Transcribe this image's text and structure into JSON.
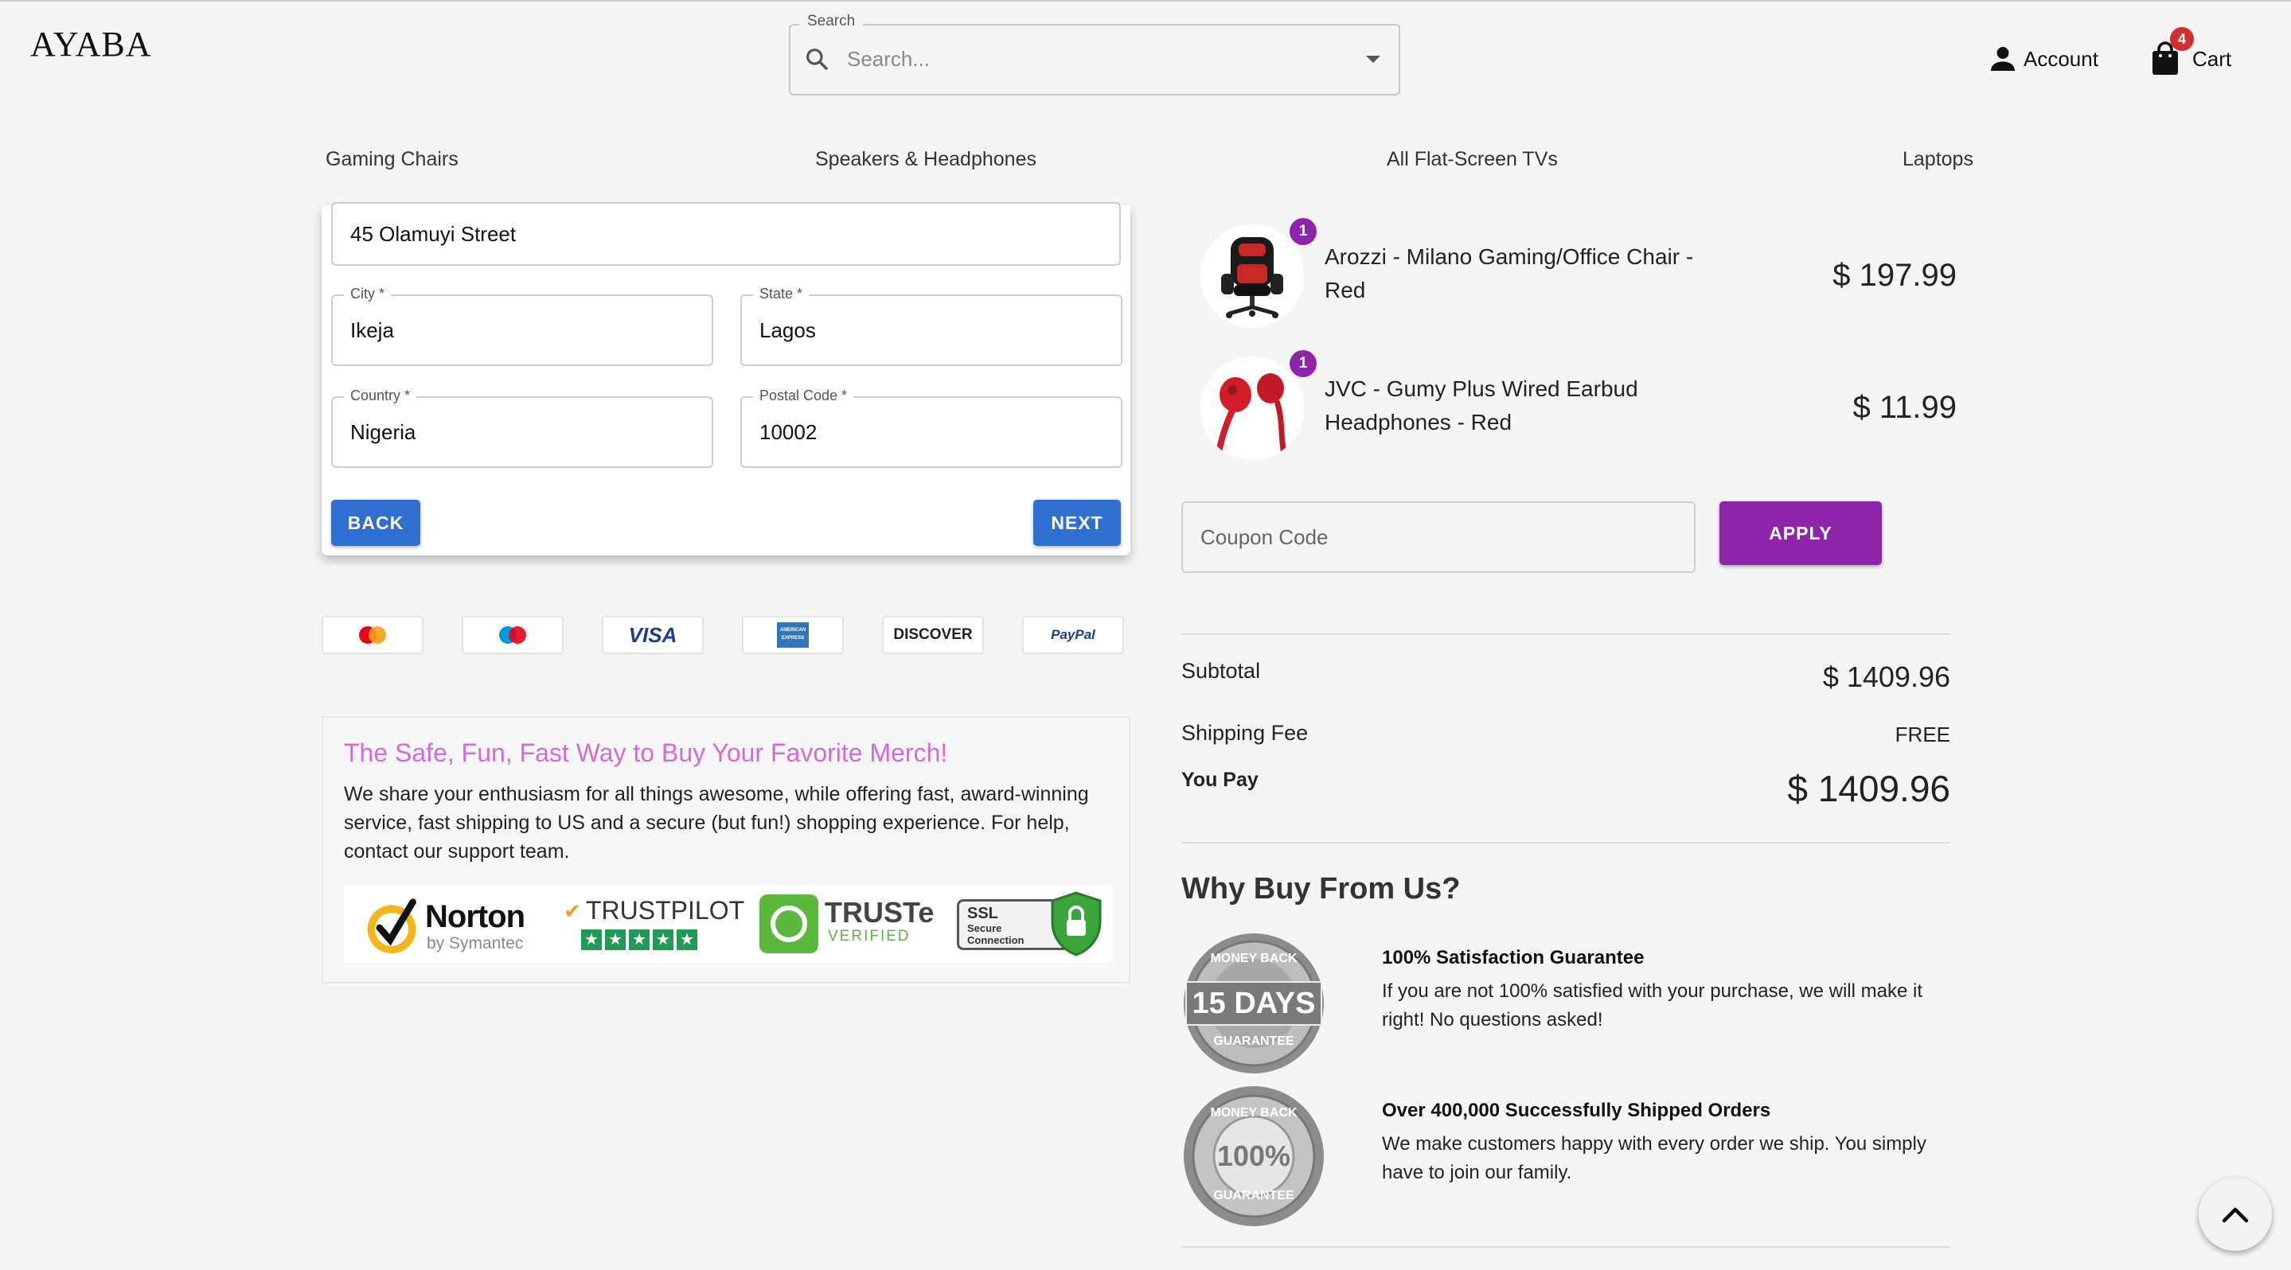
{
  "header": {
    "logo": "AYABA",
    "search": {
      "legend": "Search",
      "placeholder": "Search..."
    },
    "account_label": "Account",
    "cart_label": "Cart",
    "cart_count": "4"
  },
  "nav": {
    "items": [
      {
        "label": "Gaming Chairs"
      },
      {
        "label": "Speakers & Headphones"
      },
      {
        "label": "All Flat-Screen TVs"
      },
      {
        "label": "Laptops"
      }
    ]
  },
  "address_form": {
    "street": {
      "value": "45 Olamuyi Street"
    },
    "city": {
      "label": "City *",
      "value": "Ikeja"
    },
    "state": {
      "label": "State *",
      "value": "Lagos"
    },
    "country": {
      "label": "Country *",
      "value": "Nigeria"
    },
    "postal_code": {
      "label": "Postal Code *",
      "value": "10002"
    },
    "back_label": "BACK",
    "next_label": "NEXT"
  },
  "payment_methods": [
    {
      "name": "mastercard-icon"
    },
    {
      "name": "maestro-icon"
    },
    {
      "name": "visa-icon",
      "text": "VISA"
    },
    {
      "name": "amex-icon",
      "text": "AMERICAN EXPRESS"
    },
    {
      "name": "discover-icon",
      "text": "DISCOVER"
    },
    {
      "name": "paypal-icon",
      "text": "PayPal"
    }
  ],
  "info_box": {
    "title": "The Safe, Fun, Fast Way to Buy Your Favorite Merch!",
    "body": "We share your enthusiasm for all things awesome, while offering fast, award-winning service, fast shipping to US and a secure (but fun!) shopping experience. For help, contact our support team.",
    "trust_badges": {
      "norton": "Norton",
      "norton_sub": "by Symantec",
      "trustpilot": "TRUSTPILOT",
      "truste": "TRUSTe",
      "truste_sub": "VERIFIED",
      "ssl": "SSL",
      "ssl_sub1": "Secure",
      "ssl_sub2": "Connection"
    }
  },
  "order": {
    "items": [
      {
        "name": "Arozzi - Milano Gaming/Office Chair - Red",
        "price": "$ 197.99",
        "qty": "1"
      },
      {
        "name": "JVC - Gumy Plus Wired Earbud Headphones - Red",
        "price": "$ 11.99",
        "qty": "1"
      }
    ],
    "coupon_placeholder": "Coupon Code",
    "apply_label": "APPLY",
    "subtotal_label": "Subtotal",
    "subtotal_value": "$ 1409.96",
    "shipping_label": "Shipping Fee",
    "shipping_value": "FREE",
    "you_pay_label": "You Pay",
    "you_pay_value": "$ 1409.96"
  },
  "why": {
    "title": "Why Buy From Us?",
    "items": [
      {
        "title": "100% Satisfaction Guarantee",
        "body": "If you are not 100% satisfied with your purchase, we will make it right! No questions asked!",
        "seal_top": "MONEY BACK",
        "seal_main": "15 DAYS",
        "seal_bottom": "GUARANTEE"
      },
      {
        "title": "Over 400,000 Successfully Shipped Orders",
        "body": "We make customers happy with every order we ship. You simply have to join our family.",
        "seal_top": "MONEY BACK",
        "seal_main": "100%",
        "seal_bottom": "GUARANTEE"
      }
    ]
  },
  "colors": {
    "primary_blue": "#2f6fcf",
    "accent_purple": "#8e24aa",
    "headline_pink": "#d46ad8",
    "badge_red": "#d32f2f"
  }
}
